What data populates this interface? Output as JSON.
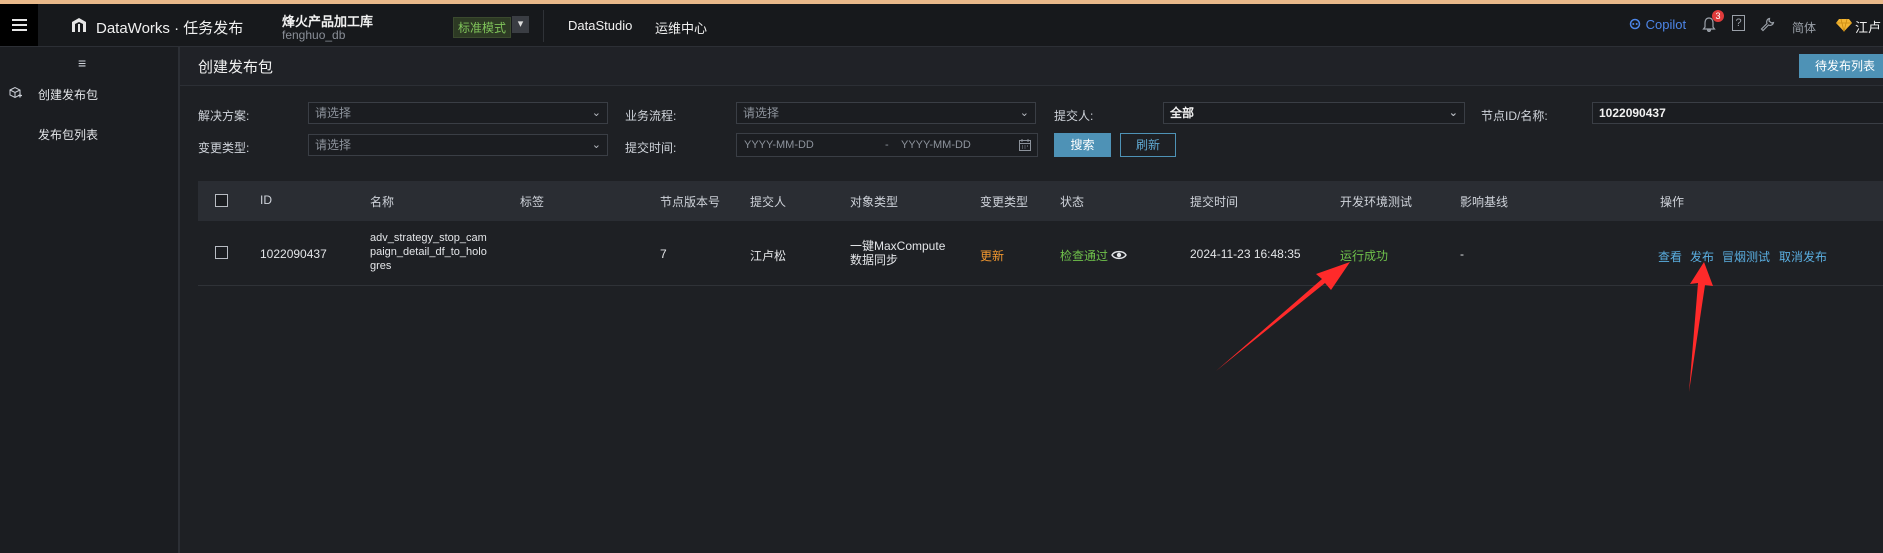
{
  "header": {
    "app_title": "DataWorks · 任务发布",
    "workspace_name": "烽火产品加工库",
    "workspace_db": "fenghuo_db",
    "mode_badge": "标准模式",
    "nav": [
      "DataStudio",
      "运维中心"
    ],
    "copilot": "Copilot",
    "notification_count": "3",
    "help_icon": "?",
    "lang": "简体",
    "user_name": "江卢"
  },
  "sidebar": {
    "items": [
      {
        "label": "创建发布包"
      },
      {
        "label": "发布包列表"
      }
    ]
  },
  "page": {
    "title": "创建发布包",
    "pending_button": "待发布列表"
  },
  "filters": {
    "solution": {
      "label": "解决方案:",
      "placeholder": "请选择"
    },
    "workflow": {
      "label": "业务流程:",
      "placeholder": "请选择"
    },
    "submitter": {
      "label": "提交人:",
      "value": "全部"
    },
    "node_id_label": "节点ID/名称:",
    "node_id_value": "1022090437",
    "change_type": {
      "label": "变更类型:",
      "placeholder": "请选择"
    },
    "submit_time": {
      "label": "提交时间:",
      "start_placeholder": "YYYY-MM-DD",
      "sep": "-",
      "end_placeholder": "YYYY-MM-DD"
    },
    "search_button": "搜索",
    "refresh_button": "刷新"
  },
  "table": {
    "columns": [
      "ID",
      "名称",
      "标签",
      "节点版本号",
      "提交人",
      "对象类型",
      "变更类型",
      "状态",
      "提交时间",
      "开发环境测试",
      "影响基线",
      "操作"
    ],
    "rows": [
      {
        "id": "1022090437",
        "name_lines": [
          "adv_strategy_stop_cam",
          "paign_detail_df_to_holo",
          "gres"
        ],
        "tag": "",
        "version": "7",
        "submitter": "江卢松",
        "object_type_lines": [
          "一键MaxCompute",
          "数据同步"
        ],
        "change_type": "更新",
        "status": "检查通过",
        "submit_time": "2024-11-23 16:48:35",
        "dev_test": "运行成功",
        "baseline": "-",
        "actions": [
          "查看",
          "发布",
          "冒烟测试",
          "取消发布"
        ]
      }
    ]
  },
  "colors": {
    "accent": "#4e92b6",
    "success": "#6fc14b",
    "warning": "#f0962f",
    "arrow": "#ff2a2a"
  }
}
